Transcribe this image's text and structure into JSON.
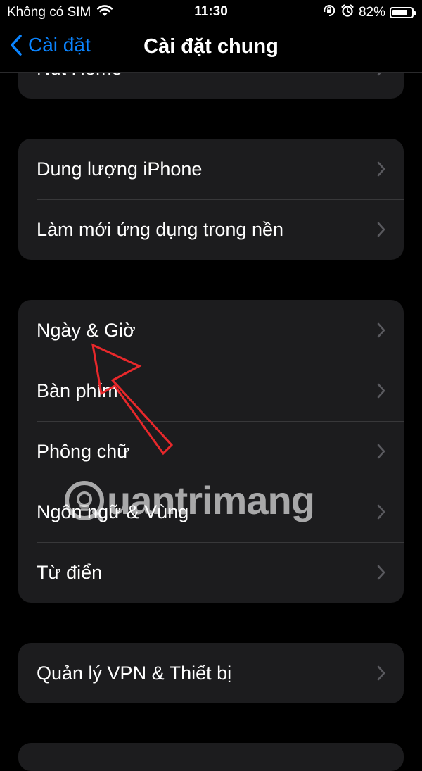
{
  "status_bar": {
    "carrier": "Không có SIM",
    "time": "11:30",
    "battery_percent": "82%",
    "battery_level": 0.82,
    "icons": [
      "wifi-icon",
      "orientation-lock-icon",
      "alarm-icon",
      "battery-icon"
    ]
  },
  "nav": {
    "back_label": "Cài đặt",
    "title": "Cài đặt chung"
  },
  "groups": [
    {
      "rows": [
        "Nút Home"
      ]
    },
    {
      "rows": [
        "Dung lượng iPhone",
        "Làm mới ứng dụng trong nền"
      ]
    },
    {
      "rows": [
        "Ngày & Giờ",
        "Bàn phím",
        "Phông chữ",
        "Ngôn ngữ & Vùng",
        "Từ điển"
      ]
    },
    {
      "rows": [
        "Quản lý VPN & Thiết bị"
      ]
    }
  ],
  "watermark": {
    "text": "uantrimang"
  },
  "colors": {
    "background": "#000000",
    "cell": "#1c1c1e",
    "separator": "#38383a",
    "accent": "#0a84ff",
    "chevron": "#5a5a5f",
    "annotation_arrow": "#e8282b"
  }
}
